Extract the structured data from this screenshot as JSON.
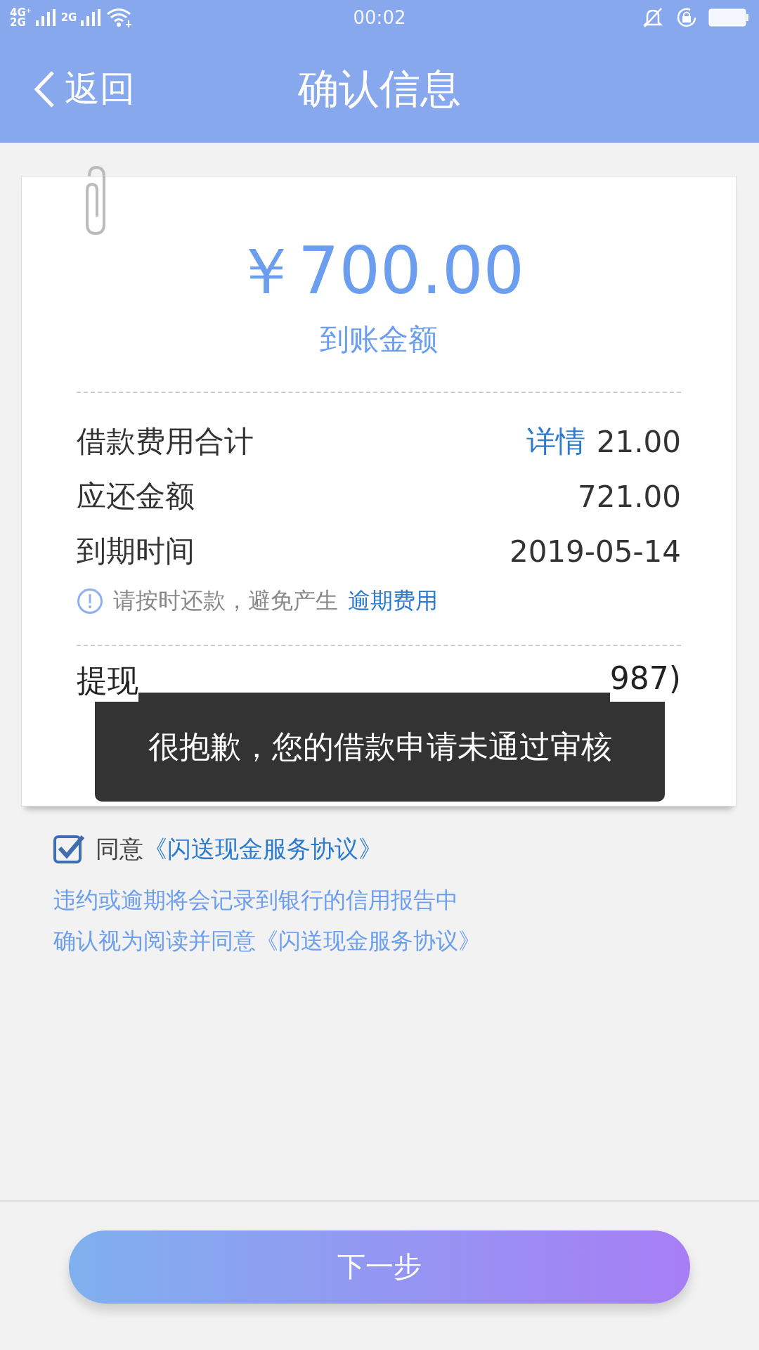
{
  "status_bar": {
    "network_1": "4G⁺",
    "network_2": "2G",
    "network_3": "2G",
    "time": "00:02"
  },
  "header": {
    "back": "返回",
    "title": "确认信息"
  },
  "receipt": {
    "amount": "￥700.00",
    "amount_label": "到账金额",
    "rows": [
      {
        "label": "借款费用合计",
        "link": "详情",
        "value": "21.00"
      },
      {
        "label": "应还金额",
        "value": "721.00"
      },
      {
        "label": "到期时间",
        "value": "2019-05-14"
      }
    ],
    "notice": {
      "text": "请按时还款，避免产生",
      "link": "逾期费用"
    },
    "card_row": {
      "label": "提现",
      "value": "987)"
    }
  },
  "agreement": {
    "checked": true,
    "label": "同意",
    "link": "《闪送现金服务协议》"
  },
  "notes": [
    "违约或逾期将会记录到银行的信用报告中",
    "确认视为阅读并同意《闪送现金服务协议》"
  ],
  "next_button": "下一步",
  "toast": "很抱歉，您的借款申请未通过审核"
}
